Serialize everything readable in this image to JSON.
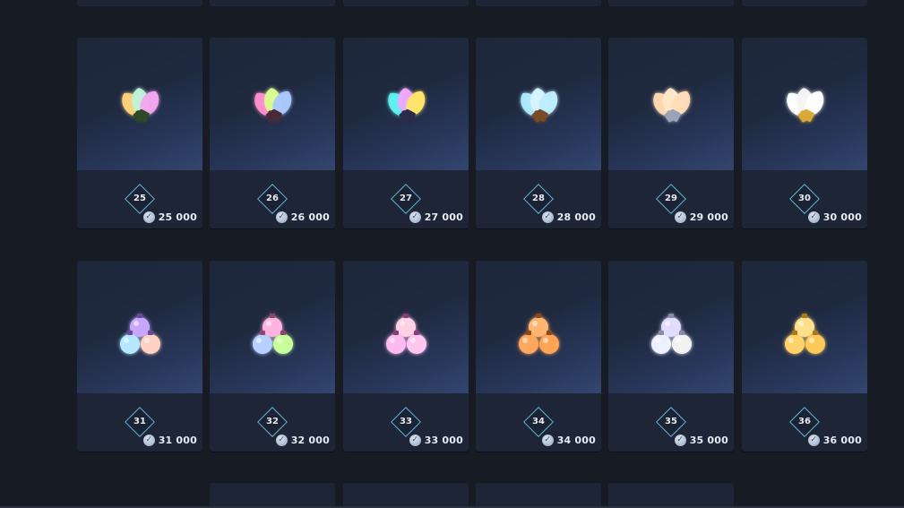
{
  "palette": {
    "background": "#161b24",
    "card": "#1d2536",
    "badge_border": "#5fb3d3",
    "text": "#e6ebf2"
  },
  "currency_icon": "silver-coin-icon",
  "rewards": [
    {
      "level": "25",
      "price": "25 000",
      "item": "christmas-bulbs-icon",
      "colors": [
        "#ffd27a",
        "#bff3d8",
        "#f3a6ee"
      ],
      "base": "#2e4a2a"
    },
    {
      "level": "26",
      "price": "26 000",
      "item": "christmas-bulbs-icon",
      "colors": [
        "#ff8fcf",
        "#d9ff8f",
        "#a9c8ff"
      ],
      "base": "#4a2a38"
    },
    {
      "level": "27",
      "price": "27 000",
      "item": "christmas-bulbs-icon",
      "colors": [
        "#5ff0f0",
        "#f0a8ff",
        "#ffe66a"
      ],
      "base": "#2c2a4a"
    },
    {
      "level": "28",
      "price": "28 000",
      "item": "christmas-bulbs-icon",
      "colors": [
        "#aeeaff",
        "#d6f4ff",
        "#bdeeff"
      ],
      "base": "#7a4a28"
    },
    {
      "level": "29",
      "price": "29 000",
      "item": "christmas-bulbs-icon",
      "colors": [
        "#ffd8b0",
        "#ffe8c8",
        "#ffdcb8"
      ],
      "base": "#9aa3b8"
    },
    {
      "level": "30",
      "price": "30 000",
      "item": "christmas-bulbs-icon",
      "colors": [
        "#ffffff",
        "#f4f4f4",
        "#ffffff"
      ],
      "base": "#d9a838"
    },
    {
      "level": "31",
      "price": "31 000",
      "item": "ornament-baubles-icon",
      "colors": [
        "#b3e8ff",
        "#c7a6ff",
        "#ffd1c2"
      ],
      "base": "#6a4a9a"
    },
    {
      "level": "32",
      "price": "32 000",
      "item": "ornament-baubles-icon",
      "colors": [
        "#b7d0ff",
        "#ffb3e0",
        "#c8ff9a"
      ],
      "base": "#8a4a6a"
    },
    {
      "level": "33",
      "price": "33 000",
      "item": "ornament-baubles-icon",
      "colors": [
        "#ffb8f0",
        "#ffd0e6",
        "#ffc6ee"
      ],
      "base": "#8a3a7a"
    },
    {
      "level": "34",
      "price": "34 000",
      "item": "ornament-baubles-icon",
      "colors": [
        "#ffa75c",
        "#ffb56f",
        "#ffa454"
      ],
      "base": "#8a4a1a"
    },
    {
      "level": "35",
      "price": "35 000",
      "item": "ornament-baubles-icon",
      "colors": [
        "#eef0ff",
        "#e2ddff",
        "#f2f2f2"
      ],
      "base": "#8a8aa8"
    },
    {
      "level": "36",
      "price": "36 000",
      "item": "ornament-baubles-icon",
      "colors": [
        "#ffd36a",
        "#ffe08a",
        "#ffc95a"
      ],
      "base": "#a77a1a"
    }
  ]
}
